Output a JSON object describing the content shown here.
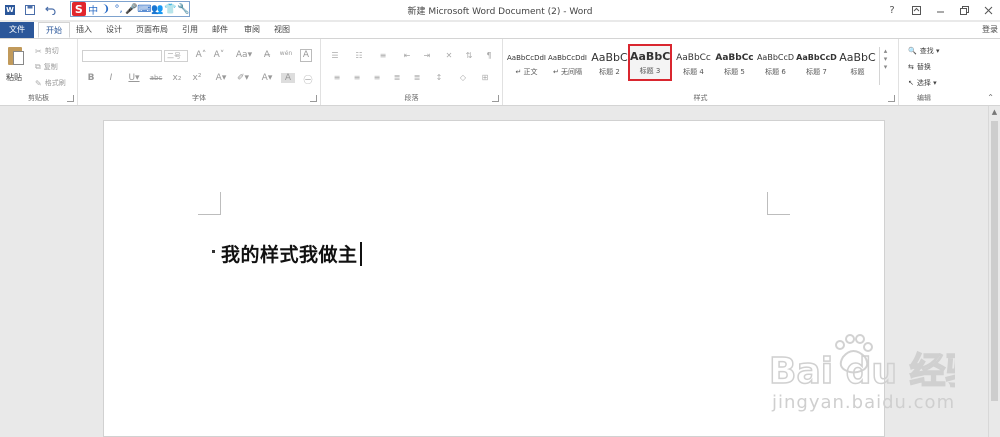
{
  "window": {
    "title": "新建 Microsoft Word Document (2) - Word",
    "help": "?",
    "login": "登录"
  },
  "tabs": [
    {
      "label": "文件"
    },
    {
      "label": "开始"
    },
    {
      "label": "插入"
    },
    {
      "label": "设计"
    },
    {
      "label": "页面布局"
    },
    {
      "label": "引用"
    },
    {
      "label": "邮件"
    },
    {
      "label": "审阅"
    },
    {
      "label": "视图"
    }
  ],
  "ime": {
    "chars": [
      "中",
      "❩",
      "°,",
      "🎤",
      "⌨",
      "👥",
      "👕",
      "🔧"
    ]
  },
  "clipboard": {
    "paste": "粘贴",
    "cut": "剪切",
    "copy": "复制",
    "format_painter": "格式刷",
    "label": "剪贴板"
  },
  "font": {
    "size": "二号",
    "label": "字体",
    "row1": [
      "A˄",
      "A˅",
      "Aa▾",
      "A̶",
      "wén",
      "A"
    ],
    "row2": [
      "B",
      "I",
      "U▾",
      "abc",
      "x₂",
      "x²",
      "A▾",
      "✐▾",
      "A▾",
      "A",
      "㊀"
    ]
  },
  "paragraph": {
    "label": "段落"
  },
  "styles": {
    "label": "样式",
    "items": [
      {
        "preview": "AaBbCcDdI",
        "name": "↵ 正文"
      },
      {
        "preview": "AaBbCcDdI",
        "name": "↵ 无间隔"
      },
      {
        "preview": "AaBbC",
        "name": "标题 2"
      },
      {
        "preview": "AaBbC",
        "name": "标题 3"
      },
      {
        "preview": "AaBbCc",
        "name": "标题 4"
      },
      {
        "preview": "AaBbCc",
        "name": "标题 5"
      },
      {
        "preview": "AaBbCcD",
        "name": "标题 6"
      },
      {
        "preview": "AaBbCcD",
        "name": "标题 7"
      },
      {
        "preview": "AaBbC",
        "name": "标题"
      }
    ]
  },
  "editing": {
    "find": "查找 ▾",
    "replace": "替换",
    "select": "选择 ▾",
    "label": "编辑"
  },
  "document": {
    "heading": "我的样式我做主"
  },
  "watermark": {
    "brand": "Bai du 经验",
    "url": "jingyan.baidu.com"
  }
}
